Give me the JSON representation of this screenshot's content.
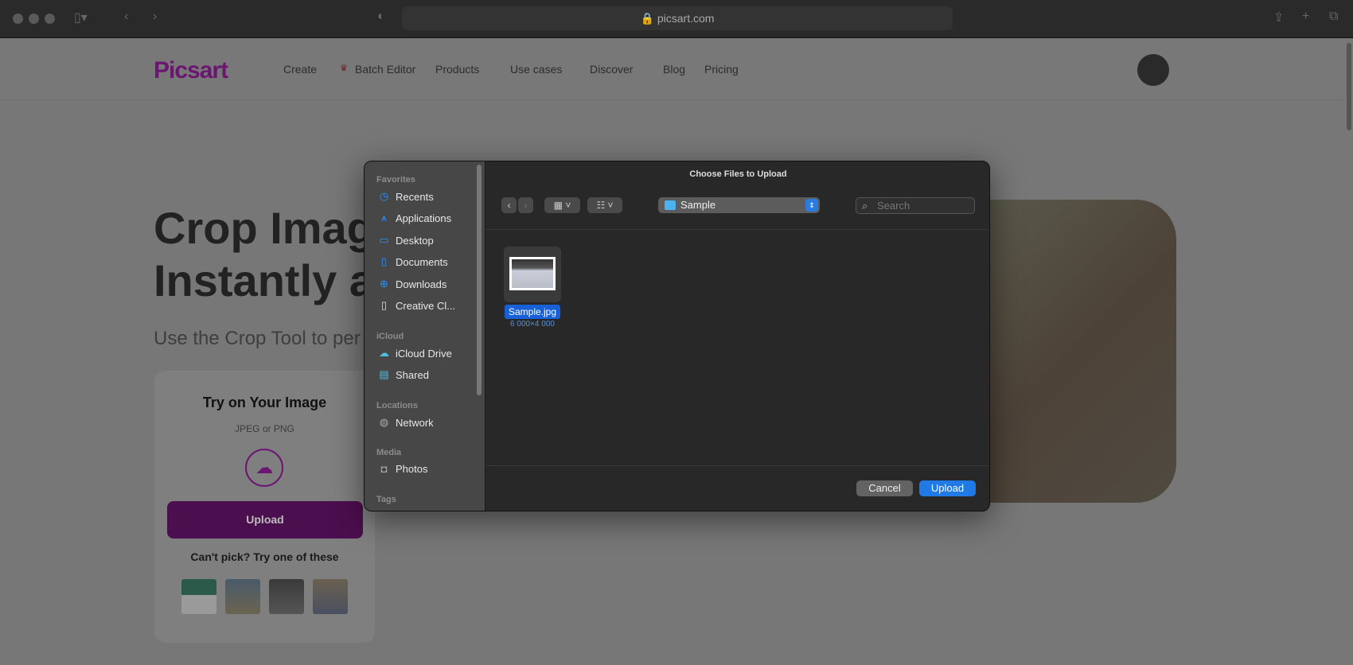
{
  "browser": {
    "url": "picsart.com"
  },
  "nav": {
    "logo": "Picsart",
    "items": [
      "Create",
      "Batch Editor",
      "Products",
      "Use cases",
      "Discover",
      "Blog",
      "Pricing"
    ]
  },
  "hero": {
    "line1": "Crop Imag",
    "line2": "Instantly a",
    "subtitle": "Use the Crop Tool to per"
  },
  "card": {
    "title": "Try on Your Image",
    "formats": "JPEG or PNG",
    "upload": "Upload",
    "cant_pick": "Can't pick? Try one of these"
  },
  "dialog": {
    "title": "Choose Files to Upload",
    "sections": {
      "favorites": "Favorites",
      "icloud": "iCloud",
      "locations": "Locations",
      "media": "Media",
      "tags": "Tags"
    },
    "favorites": [
      "Recents",
      "Applications",
      "Desktop",
      "Documents",
      "Downloads",
      "Creative Cl..."
    ],
    "icloud": [
      "iCloud Drive",
      "Shared"
    ],
    "locations": [
      "Network"
    ],
    "media": [
      "Photos"
    ],
    "folder": "Sample",
    "search_placeholder": "Search",
    "file": {
      "name": "Sample.jpg",
      "size": "6 000×4 000"
    },
    "cancel": "Cancel",
    "upload": "Upload"
  }
}
